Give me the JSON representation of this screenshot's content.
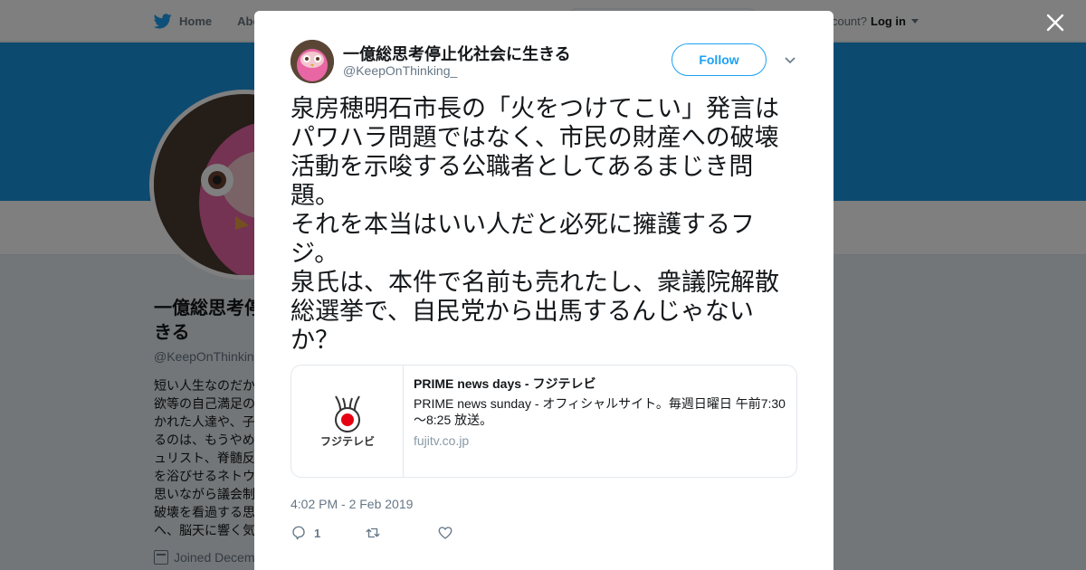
{
  "nav": {
    "home": "Home",
    "about": "Abo"
  },
  "login": {
    "prompt": "account?",
    "link": "Log in"
  },
  "profile": {
    "name_line1": "一億総思考停",
    "name_line2": "きる",
    "handle": "@KeepOnThinkin",
    "bio_lines": [
      "短い人生なのだか",
      "欲等の自己満足の",
      "かれた人達や、子",
      "るのは、もうやめ",
      "ュリスト、脊髄反",
      "を浴びせるネトウ",
      "思いながら議会制",
      "破壊を看過する思",
      "へ、脳天に響く気"
    ],
    "joined": "Joined Decem"
  },
  "tweet": {
    "display_name": "一億総思考停止化社会に生きる",
    "handle": "@KeepOnThinking_",
    "follow_label": "Follow",
    "text_lines": [
      "泉房穂明石市長の「火をつけてこい」発言は",
      "パワハラ問題ではなく、市民の財産への破壊",
      "活動を示唆する公職者としてあるまじき問",
      "題。",
      "それを本当はいい人だと必死に擁護するフ",
      "ジ。",
      "泉氏は、本件で名前も売れたし、衆議院解散",
      "総選挙で、自民党から出馬するんじゃない",
      "か？"
    ],
    "card": {
      "logo_text": "フジテレビ",
      "title": "PRIME news days - フジテレビ",
      "desc_line1": "PRIME news sunday - オフィシャルサイト。毎週日曜日 午前7:30",
      "desc_line2": "～8:25 放送。",
      "domain": "fujitv.co.jp"
    },
    "timestamp": "4:02 PM - 2 Feb 2019",
    "reply_count": "1",
    "retweet_count": "",
    "like_count": ""
  },
  "colors": {
    "accent": "#1da1f2",
    "banner": "#1b95e0",
    "overlay": "rgba(0,0,0,0.5)"
  },
  "icons": [
    "twitter-bird-icon",
    "close-icon",
    "chevron-down-icon",
    "reply-icon",
    "retweet-icon",
    "heart-icon",
    "calendar-icon"
  ]
}
